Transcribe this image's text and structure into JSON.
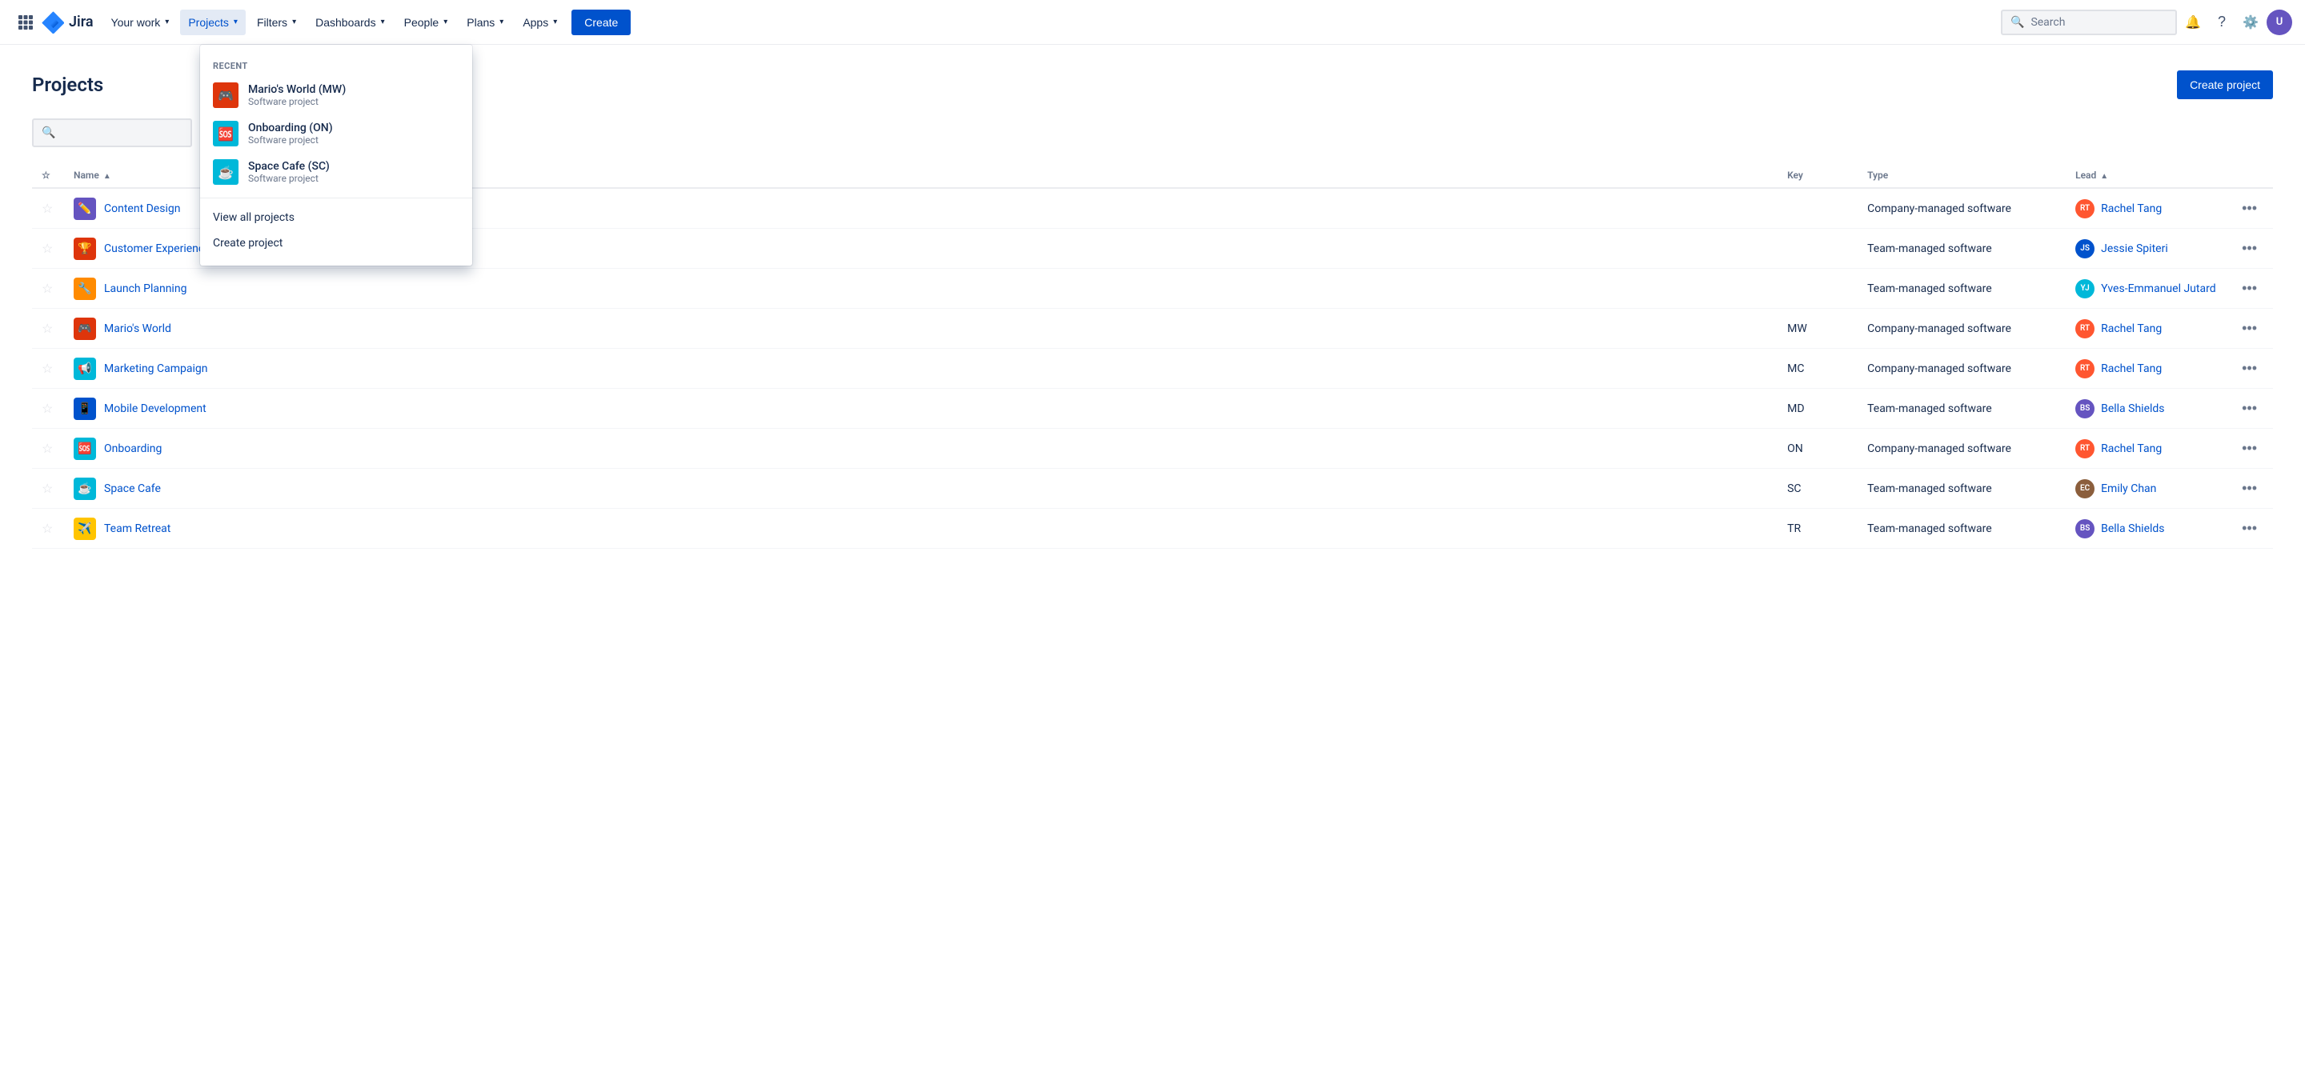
{
  "nav": {
    "logo_text": "Jira",
    "items": [
      {
        "id": "your-work",
        "label": "Your work",
        "has_chevron": true,
        "active": false
      },
      {
        "id": "projects",
        "label": "Projects",
        "has_chevron": true,
        "active": true
      },
      {
        "id": "filters",
        "label": "Filters",
        "has_chevron": true,
        "active": false
      },
      {
        "id": "dashboards",
        "label": "Dashboards",
        "has_chevron": true,
        "active": false
      },
      {
        "id": "people",
        "label": "People",
        "has_chevron": true,
        "active": false
      },
      {
        "id": "plans",
        "label": "Plans",
        "has_chevron": true,
        "active": false
      },
      {
        "id": "apps",
        "label": "Apps",
        "has_chevron": true,
        "active": false
      }
    ],
    "create_label": "Create",
    "search_placeholder": "Search"
  },
  "dropdown": {
    "section_label": "RECENT",
    "recent_items": [
      {
        "id": "mw",
        "name": "Mario's World (MW)",
        "sub": "Software project",
        "icon": "🎮",
        "bg": "red"
      },
      {
        "id": "on",
        "name": "Onboarding (ON)",
        "sub": "Software project",
        "icon": "🆘",
        "bg": "teal"
      },
      {
        "id": "sc",
        "name": "Space Cafe (SC)",
        "sub": "Software project",
        "icon": "☕",
        "bg": "teal"
      }
    ],
    "view_all_label": "View all projects",
    "create_label": "Create project"
  },
  "page": {
    "title": "Projects",
    "create_project_label": "Create project",
    "search_placeholder": ""
  },
  "table": {
    "headers": {
      "star": "",
      "name": "Name",
      "key": "Key",
      "type": "Type",
      "lead": "Lead",
      "more": ""
    },
    "rows": [
      {
        "id": "cd",
        "star": false,
        "name": "Content Design",
        "key": "",
        "type": "Company-managed software",
        "lead_name": "Rachel Tang",
        "lead_initials": "RT",
        "lead_color": "pink",
        "icon": "✏️",
        "icon_bg": "purple"
      },
      {
        "id": "ce",
        "star": false,
        "name": "Customer Experience",
        "key": "",
        "type": "Team-managed software",
        "lead_name": "Jessie Spiteri",
        "lead_initials": "JS",
        "lead_color": "blue",
        "icon": "🏆",
        "icon_bg": "red",
        "truncated": true
      },
      {
        "id": "lp",
        "star": false,
        "name": "Launch Planning",
        "key": "",
        "type": "Team-managed software",
        "lead_name": "Yves-Emmanuel Jutard",
        "lead_initials": "YJ",
        "lead_color": "teal",
        "icon": "🔧",
        "icon_bg": "orange",
        "truncated": true
      },
      {
        "id": "mw",
        "star": false,
        "name": "Mario's World",
        "key": "MW",
        "type": "Company-managed software",
        "lead_name": "Rachel Tang",
        "lead_initials": "RT",
        "lead_color": "pink",
        "icon": "🎮",
        "icon_bg": "red"
      },
      {
        "id": "mc",
        "star": false,
        "name": "Marketing Campaign",
        "key": "MC",
        "type": "Company-managed software",
        "lead_name": "Rachel Tang",
        "lead_initials": "RT",
        "lead_color": "pink",
        "icon": "📢",
        "icon_bg": "teal"
      },
      {
        "id": "md",
        "star": false,
        "name": "Mobile Development",
        "key": "MD",
        "type": "Team-managed software",
        "lead_name": "Bella Shields",
        "lead_initials": "BS",
        "lead_color": "purple",
        "icon": "📱",
        "icon_bg": "blue"
      },
      {
        "id": "on",
        "star": false,
        "name": "Onboarding",
        "key": "ON",
        "type": "Company-managed software",
        "lead_name": "Rachel Tang",
        "lead_initials": "RT",
        "lead_color": "pink",
        "icon": "🆘",
        "icon_bg": "teal"
      },
      {
        "id": "sc",
        "star": false,
        "name": "Space Cafe",
        "key": "SC",
        "type": "Team-managed software",
        "lead_name": "Emily Chan",
        "lead_initials": "EC",
        "lead_color": "brown",
        "icon": "☕",
        "icon_bg": "teal"
      },
      {
        "id": "tr",
        "star": false,
        "name": "Team Retreat",
        "key": "TR",
        "type": "Team-managed software",
        "lead_name": "Bella Shields",
        "lead_initials": "BS",
        "lead_color": "purple",
        "icon": "✈️",
        "icon_bg": "yellow"
      }
    ]
  }
}
